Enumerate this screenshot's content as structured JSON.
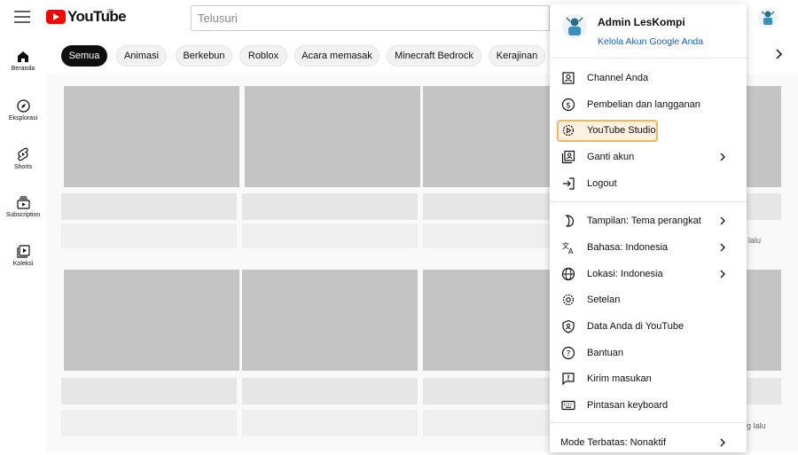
{
  "header": {
    "logo_text": "YouTube",
    "country_code": "ID",
    "search_placeholder": "Telusuri"
  },
  "sidebar": {
    "items": [
      {
        "label": "Beranda",
        "icon": "home-icon"
      },
      {
        "label": "Eksplorasi",
        "icon": "compass-icon"
      },
      {
        "label": "Shorts",
        "icon": "shorts-icon"
      },
      {
        "label": "Subscription",
        "icon": "subscriptions-icon"
      },
      {
        "label": "Koleksi",
        "icon": "library-icon"
      }
    ]
  },
  "chips": [
    "Semua",
    "Animasi",
    "Berkebun",
    "Roblox",
    "Acara memasak",
    "Minecraft Bedrock",
    "Kerajinan"
  ],
  "feed": {
    "peek_text_1": "lalu",
    "peek_text_2": "g lalu"
  },
  "account_menu": {
    "name": "Admin LesKompi",
    "manage_link": "Kelola Akun Google Anda",
    "items_1": [
      {
        "label": "Channel Anda",
        "icon": "account-box-icon"
      },
      {
        "label": "Pembelian dan langganan",
        "icon": "dollar-circle-icon"
      },
      {
        "label": "YouTube Studio",
        "icon": "studio-gear-icon",
        "highlighted": true
      },
      {
        "label": "Ganti akun",
        "icon": "switch-account-icon",
        "submenu": true
      },
      {
        "label": "Logout",
        "icon": "logout-icon"
      }
    ],
    "items_2": [
      {
        "label": "Tampilan: Tema perangkat",
        "icon": "moon-icon",
        "submenu": true
      },
      {
        "label": "Bahasa: Indonesia",
        "icon": "translate-icon",
        "submenu": true
      },
      {
        "label": "Lokasi: Indonesia",
        "icon": "globe-icon",
        "submenu": true
      },
      {
        "label": "Setelan",
        "icon": "settings-icon"
      },
      {
        "label": "Data Anda di YouTube",
        "icon": "shield-person-icon"
      },
      {
        "label": "Bantuan",
        "icon": "help-icon"
      },
      {
        "label": "Kirim masukan",
        "icon": "feedback-icon"
      },
      {
        "label": "Pintasan keyboard",
        "icon": "keyboard-icon"
      }
    ],
    "restricted_mode": "Mode Terbatas: Nonaktif"
  },
  "colors": {
    "brand_red": "#ff0000",
    "link_blue": "#065fd4",
    "highlight_border": "#f6b55a"
  }
}
